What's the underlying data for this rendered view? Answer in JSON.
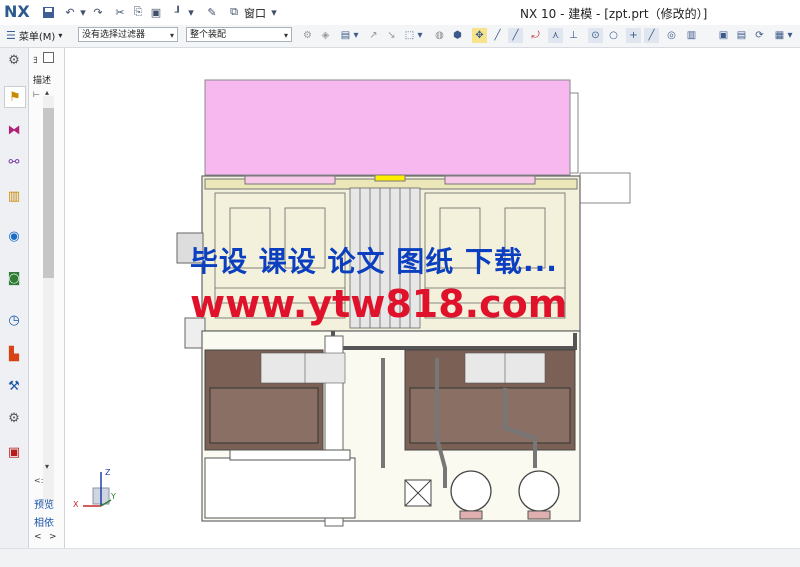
{
  "app": {
    "logo": "NX",
    "title": "NX 10 - 建模 - [zpt.prt（修改的）]",
    "window_menu": "窗口"
  },
  "toolbar": {
    "menu_label": "菜单(M)",
    "filter_combo": "没有选择过滤器",
    "assembly_combo": "整个装配"
  },
  "navigator": {
    "column_header": "描述",
    "preview": "预览",
    "dependencies": "相依",
    "prev": "<",
    "next": ">",
    "scroll_mark": "<:"
  },
  "triad": {
    "x": "X",
    "y": "Y",
    "z": "Z"
  },
  "watermark": {
    "line1": "毕设 课设 论文 图纸 下载...",
    "line2": "www.ytw818.com"
  },
  "colors": {
    "accent": "#2c5a8c",
    "pink_block": "#f7b8f0",
    "machine_frame": "#7a7a7a",
    "tank_brown": "#7b6155",
    "watermark_blue": "#0b3fbf",
    "watermark_red": "#e0122b"
  }
}
